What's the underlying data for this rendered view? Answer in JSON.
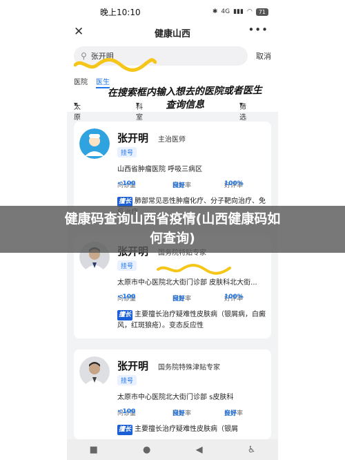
{
  "status": {
    "time": "晚上10:10",
    "signal": "4G",
    "battery": "71"
  },
  "nav": {
    "title": "健康山西",
    "close_icon": "close-icon",
    "more_icon": "more-icon"
  },
  "search": {
    "value": "张开明",
    "cancel": "取消",
    "icon": "search-icon"
  },
  "tabs": [
    {
      "label": "医院"
    },
    {
      "label": "医生",
      "active": true
    }
  ],
  "filters": {
    "city": "太原市",
    "dept": "科室",
    "sort": "筛选"
  },
  "annotation": {
    "line1": "在搜索框内输入想去的医院或者医生",
    "line2": "查询信息"
  },
  "doctors": [
    {
      "name": "张开明",
      "title": "主治医师",
      "tag": "挂号",
      "hospital": "山西省肿瘤医院 呼吸三病区",
      "visits_label": "问诊量",
      "visits": "<100",
      "reply_label": "回复率",
      "reply": "良好",
      "praise_label": "好评率",
      "praise": "100%",
      "skill_badge": "擅长",
      "skill": "肺部常见恶性肿瘤化疗、分子靶向治疗、免疫治疗"
    },
    {
      "name": "张开明",
      "title": "国务院特贴专家",
      "tag": "挂号",
      "hospital": "太原市中心医院北大街门诊部 皮肤科北大街...",
      "visits_label": "问诊量",
      "visits": "<100",
      "reply_label": "回复率",
      "reply": "良好",
      "praise_label": "好评率",
      "praise": "100%",
      "skill_badge": "擅长",
      "skill": "主要擅长治疗疑难性皮肤病（银屑病，白癜风，红斑狼疮）。变态反应性"
    },
    {
      "name": "张开明",
      "title": "国务院特殊津贴专家",
      "tag": "挂号",
      "hospital": "太原市中心医院北大街门诊部 s皮肤科",
      "visits_label": "问诊量",
      "visits": "<100",
      "reply_label": "回复率",
      "reply": "良好",
      "praise_label": "好评率",
      "praise": "良好",
      "skill_badge": "擅长",
      "skill": "主要擅长治疗疑难性皮肤病（银屑"
    }
  ],
  "banner": {
    "line1": "健康码查询山西省疫情(山西健康码如",
    "line2": "何查询)"
  },
  "colors": {
    "accent": "#1a73e8",
    "highlight": "#f5c518"
  }
}
